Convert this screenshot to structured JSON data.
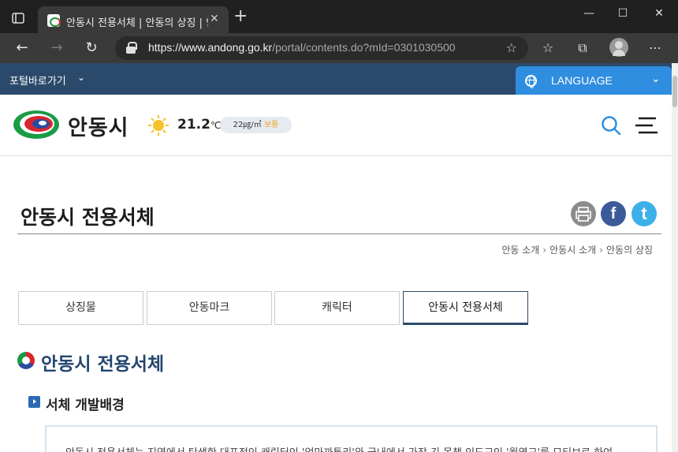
{
  "browser": {
    "tab_title": "안동시 전용서체 | 안동의 상징 | 안동시청",
    "url_scheme": "https://",
    "url_host": "www.andong.go.kr",
    "url_path": "/portal/contents.do?mId=0301030500",
    "icons": [
      "tab-actions-icon",
      "close-icon",
      "plus-icon",
      "minimize-icon",
      "maximize-icon",
      "back-icon",
      "forward-icon",
      "refresh-icon",
      "lock-icon",
      "add-favorite-icon",
      "favorites-icon",
      "collections-icon",
      "profile-icon",
      "more-icon"
    ]
  },
  "topbar": {
    "portal_link": "포털바로가기",
    "language_label": "LANGUAGE"
  },
  "header": {
    "logo_text": "안동시",
    "temperature": "21.2",
    "temperature_unit": "℃",
    "dust_value": "22㎍/㎥",
    "dust_status": "보통"
  },
  "page": {
    "title": "안동시 전용서체",
    "breadcrumb": [
      "안동 소개",
      "안동시 소개",
      "안동의 상징"
    ],
    "subtabs": [
      {
        "label": "상징물",
        "active": false
      },
      {
        "label": "안동마크",
        "active": false
      },
      {
        "label": "캐릭터",
        "active": false
      },
      {
        "label": "안동시 전용서체",
        "active": true
      }
    ],
    "section_heading": "안동시 전용서체",
    "subsection_heading": "서체 개발배경",
    "body_text": "안동시 전용서체는 지역에서 탄생한 대표적인 캐릭터인 '엄마까투리'와 국내에서 가장 긴 목책 인도교인 '월영교'를 모티브로 하여"
  },
  "colors": {
    "accent_navy": "#2b4a6b",
    "language_blue": "#2f8ee0",
    "heading_blue": "#23466f"
  }
}
